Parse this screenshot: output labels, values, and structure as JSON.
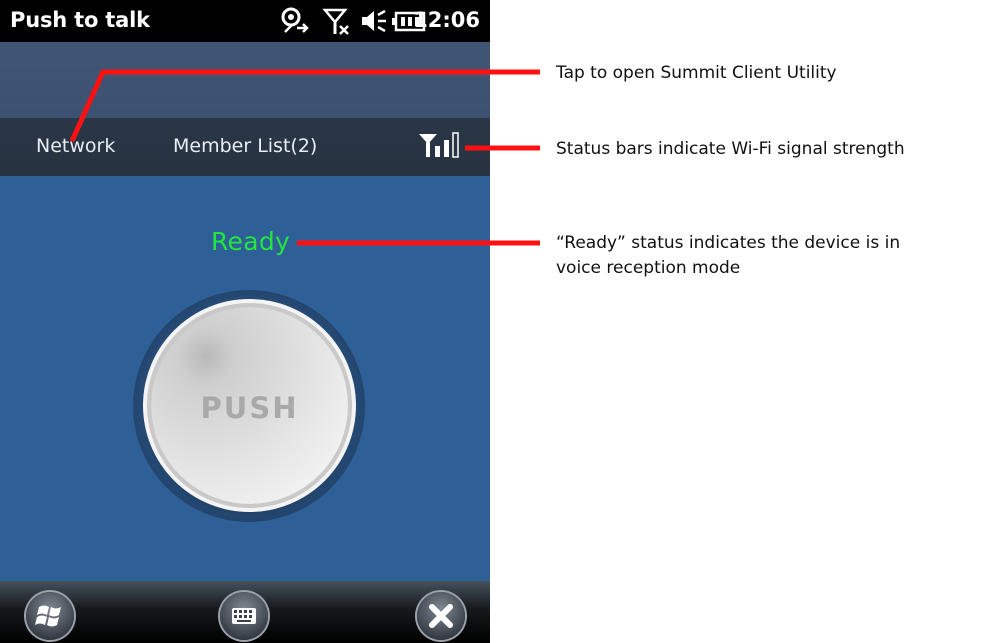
{
  "statusbar": {
    "title": "Push to talk",
    "clock": "12:06"
  },
  "menubar": {
    "network": "Network",
    "members": "Member List(2)"
  },
  "status": {
    "ready": "Ready"
  },
  "push": {
    "label": "PUSH"
  },
  "annotations": {
    "summit": "Tap to open Summit Client Utility",
    "signal": "Status bars indicate Wi-Fi signal strength",
    "ready_line1": "“Ready” status indicates the device is in",
    "ready_line2": "voice reception mode"
  },
  "colors": {
    "ready": "#22e53f",
    "annotation_line": "#ff1111",
    "screen_bg": "#2f5f97"
  }
}
